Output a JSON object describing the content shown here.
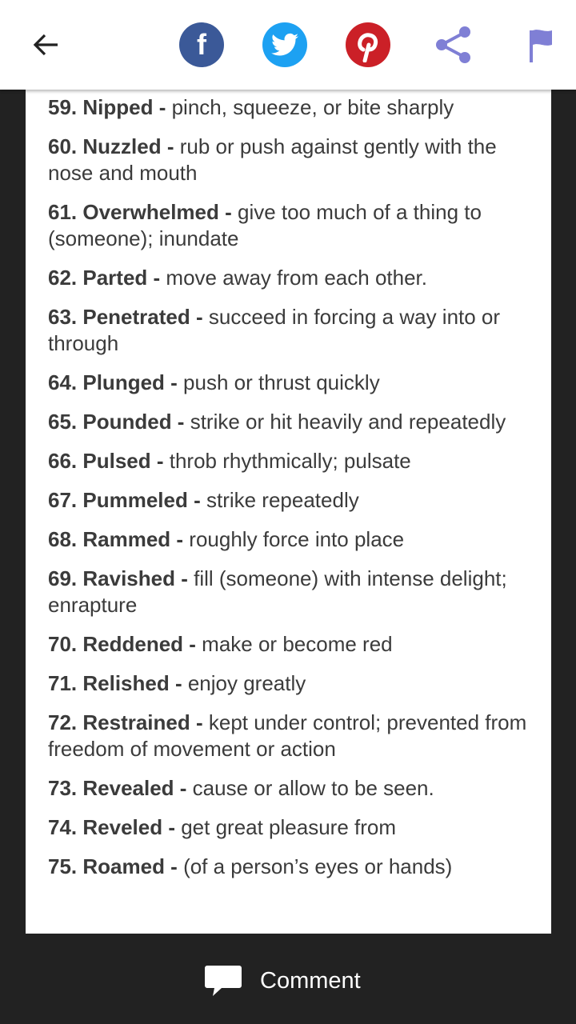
{
  "toolbar": {
    "icons": [
      "back-arrow-icon",
      "facebook-icon",
      "twitter-icon",
      "pinterest-icon",
      "share-icon",
      "flag-icon"
    ],
    "colors": {
      "facebook": "#3b5998",
      "twitter": "#1da1f2",
      "pinterest": "#cb2027",
      "accent": "#7f7fd5"
    }
  },
  "entries": [
    {
      "term": "59. Nipped",
      "def": "pinch, squeeze, or bite sharply"
    },
    {
      "term": "60. Nuzzled",
      "def": "rub or push against gently with the nose and mouth"
    },
    {
      "term": "61. Overwhelmed",
      "def": "give too much of a thing to (someone); inundate"
    },
    {
      "term": "62. Parted",
      "def": "move away from each other."
    },
    {
      "term": "63. Penetrated",
      "def": "succeed in forcing a way into or through"
    },
    {
      "term": "64. Plunged",
      "def": "push or thrust quickly"
    },
    {
      "term": "65. Pounded",
      "def": "strike or hit heavily and repeatedly"
    },
    {
      "term": "66. Pulsed",
      "def": "throb rhythmically; pulsate"
    },
    {
      "term": "67. Pummeled",
      "def": "strike repeatedly"
    },
    {
      "term": "68. Rammed",
      "def": "roughly force into place"
    },
    {
      "term": "69. Ravished",
      "def": "fill (someone) with intense delight; enrapture"
    },
    {
      "term": "70. Reddened",
      "def": "make or become red"
    },
    {
      "term": "71. Relished",
      "def": "enjoy greatly"
    },
    {
      "term": "72. Restrained",
      "def": "kept under control; prevented from freedom of movement or action"
    },
    {
      "term": "73. Revealed",
      "def": "cause or allow to be seen."
    },
    {
      "term": "74. Reveled",
      "def": "get great pleasure from"
    },
    {
      "term": "75. Roamed",
      "def": "(of a person’s eyes or hands)"
    }
  ],
  "bottom": {
    "comment_label": "Comment"
  }
}
